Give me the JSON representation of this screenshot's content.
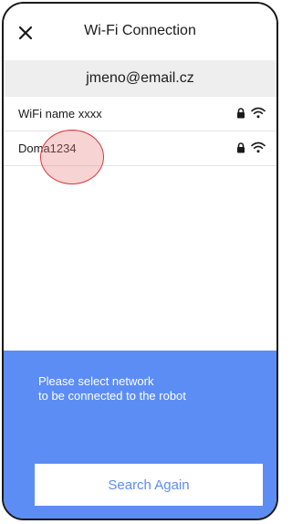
{
  "header": {
    "title": "Wi-Fi Connection",
    "close_icon": "close-icon"
  },
  "account": {
    "email": "jmeno@email.cz"
  },
  "networks": [
    {
      "name": "WiFi name xxxx",
      "secured": true,
      "signal": "strong"
    },
    {
      "name": "Doma1234",
      "secured": true,
      "signal": "strong"
    }
  ],
  "instruction": {
    "line1": "Please select network",
    "line2": "to be connected to the robot"
  },
  "actions": {
    "search_again_label": "Search Again"
  },
  "colors": {
    "accent": "#5b8df5",
    "account_bar": "#eeeeee",
    "touch_indicator": "#d83a3a"
  }
}
